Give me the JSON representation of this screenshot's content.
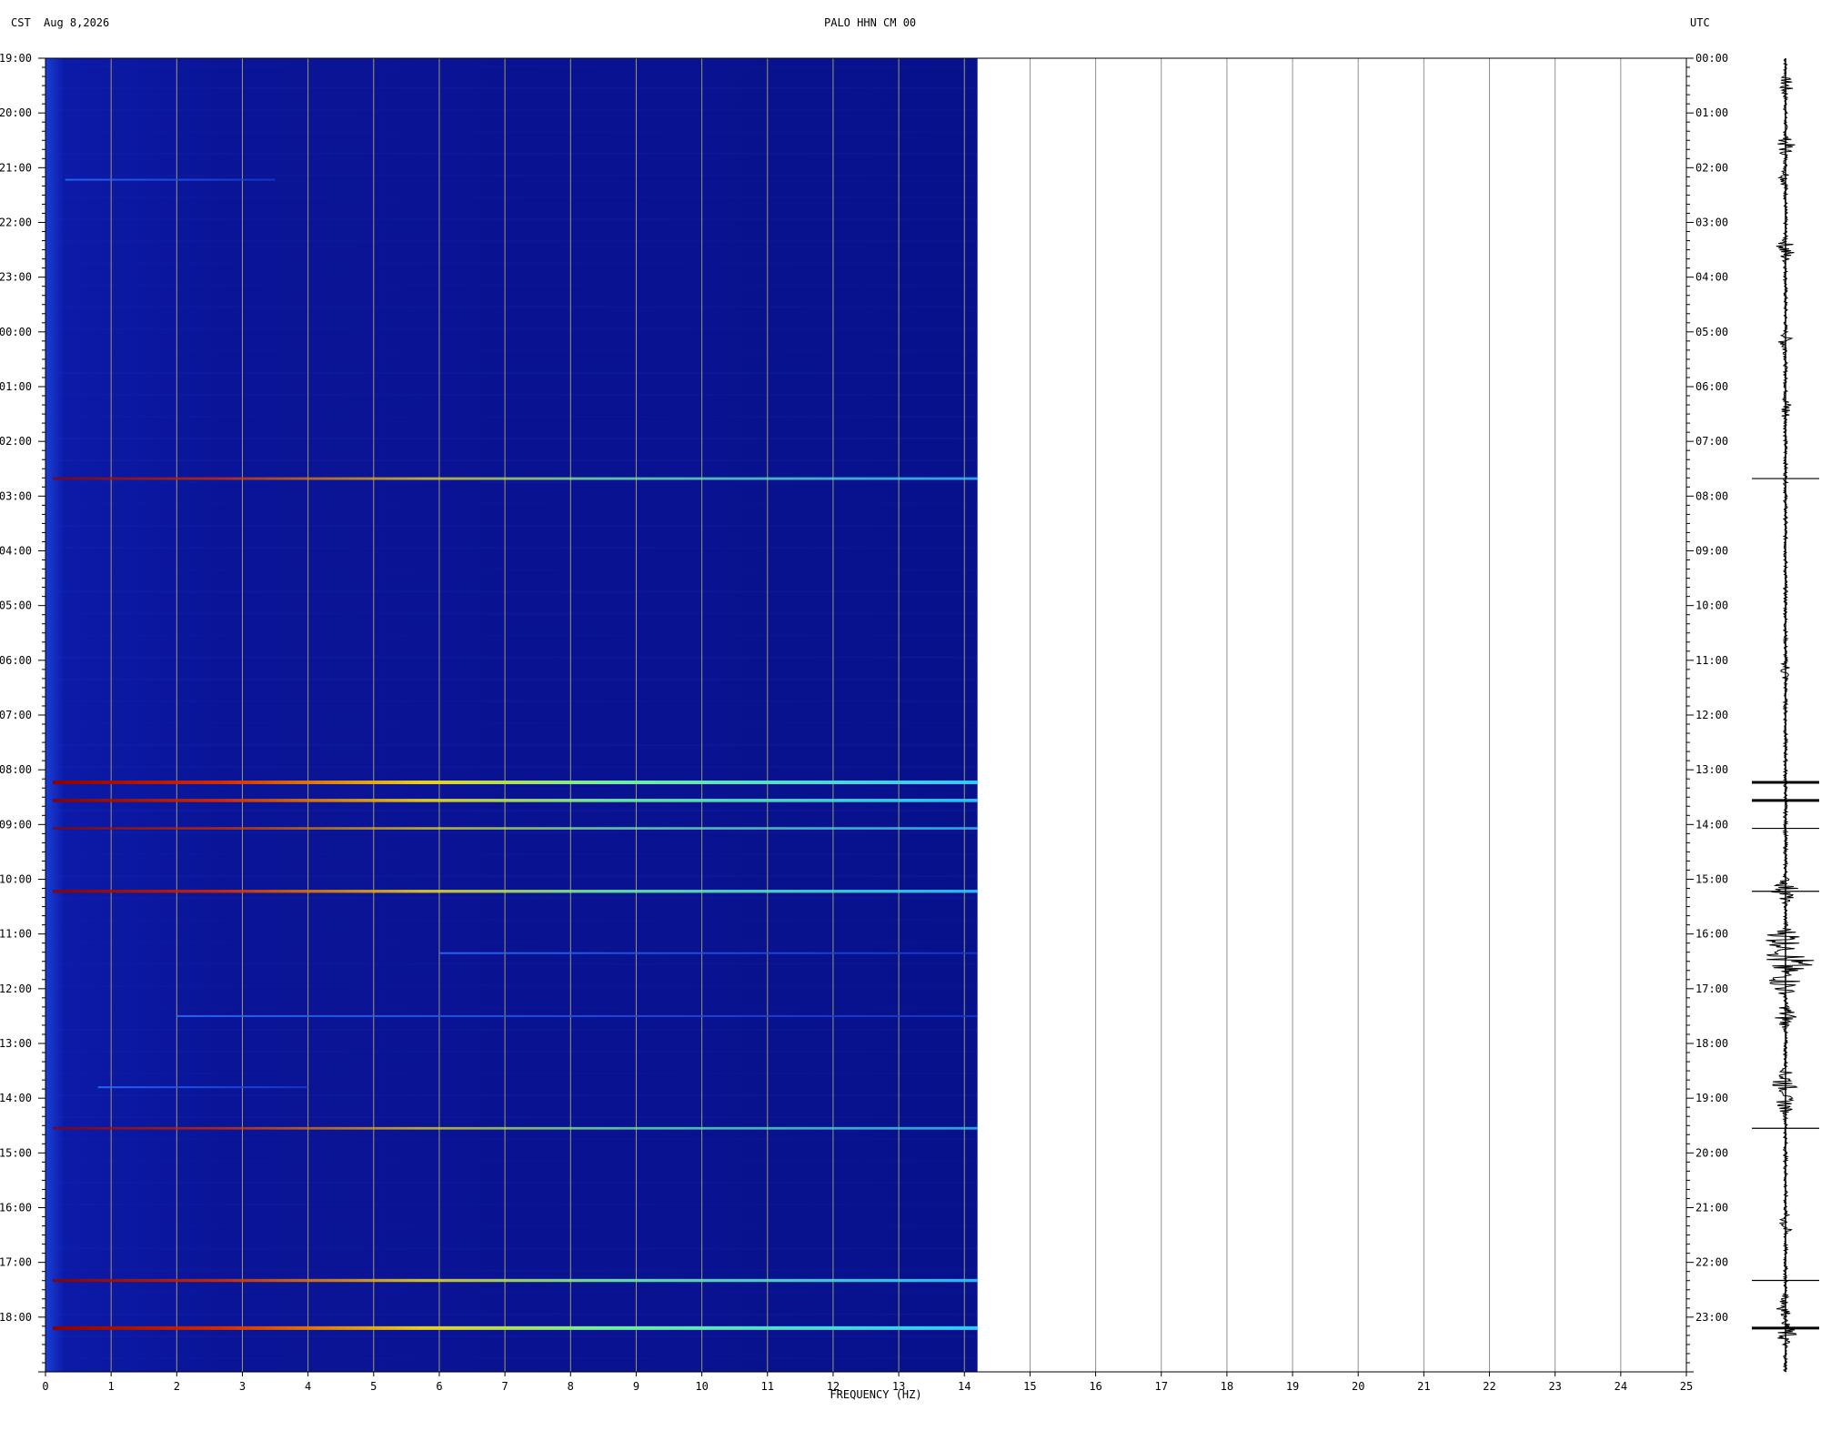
{
  "header": {
    "left_timezone": "CST",
    "date": "Aug 8,2026",
    "station": "PALO HHN CM 00",
    "right_timezone": "UTC"
  },
  "chart_data": {
    "type": "heatmap",
    "title": "PALO HHN CM 00",
    "xlabel": "FREQUENCY (HZ)",
    "ylabel": "",
    "x_ticks": [
      "0",
      "1",
      "2",
      "3",
      "4",
      "5",
      "6",
      "7",
      "8",
      "9",
      "10",
      "11",
      "12",
      "13",
      "14",
      "15",
      "16",
      "17",
      "18",
      "19",
      "20",
      "21",
      "22",
      "23",
      "24",
      "25"
    ],
    "xlim": [
      0,
      25
    ],
    "data_extent_hz": 14.2,
    "left_time_ticks": [
      "19:00",
      "20:00",
      "21:00",
      "22:00",
      "23:00",
      "00:00",
      "01:00",
      "02:00",
      "03:00",
      "04:00",
      "05:00",
      "06:00",
      "07:00",
      "08:00",
      "09:00",
      "10:00",
      "11:00",
      "12:00",
      "13:00",
      "14:00",
      "15:00",
      "16:00",
      "17:00",
      "18:00"
    ],
    "right_time_ticks": [
      "00:00",
      "01:00",
      "02:00",
      "03:00",
      "04:00",
      "05:00",
      "06:00",
      "07:00",
      "08:00",
      "09:00",
      "10:00",
      "11:00",
      "12:00",
      "13:00",
      "14:00",
      "15:00",
      "16:00",
      "17:00",
      "18:00",
      "19:00",
      "20:00",
      "21:00",
      "22:00",
      "23:00"
    ],
    "ylim_hours": [
      0,
      24
    ],
    "background_color": "#0a1496",
    "grid": true,
    "grid_color": "#a09a6a",
    "events": [
      {
        "utc_hour": 7.68,
        "strength": 0.55
      },
      {
        "utc_hour": 13.23,
        "strength": 1.0
      },
      {
        "utc_hour": 13.56,
        "strength": 0.85
      },
      {
        "utc_hour": 14.07,
        "strength": 0.5
      },
      {
        "utc_hour": 15.22,
        "strength": 0.75
      },
      {
        "utc_hour": 19.55,
        "strength": 0.5
      },
      {
        "utc_hour": 22.33,
        "strength": 0.75
      },
      {
        "utc_hour": 23.2,
        "strength": 1.0
      }
    ],
    "faint_streaks": [
      {
        "utc_hour": 2.22,
        "f_start": 0.3,
        "f_end": 3.5
      },
      {
        "utc_hour": 18.8,
        "f_start": 0.8,
        "f_end": 4.0
      },
      {
        "utc_hour": 16.35,
        "f_start": 6.0,
        "f_end": 14.2
      },
      {
        "utc_hour": 17.5,
        "f_start": 2.0,
        "f_end": 14.2
      }
    ],
    "seismogram_activity": [
      {
        "utc_hour": 0.5,
        "amp": 0.25
      },
      {
        "utc_hour": 1.6,
        "amp": 0.3
      },
      {
        "utc_hour": 2.2,
        "amp": 0.2
      },
      {
        "utc_hour": 3.5,
        "amp": 0.35
      },
      {
        "utc_hour": 5.2,
        "amp": 0.25
      },
      {
        "utc_hour": 6.4,
        "amp": 0.25
      },
      {
        "utc_hour": 11.2,
        "amp": 0.2
      },
      {
        "utc_hour": 15.2,
        "amp": 0.45
      },
      {
        "utc_hour": 16.1,
        "amp": 0.7
      },
      {
        "utc_hour": 16.5,
        "amp": 1.0
      },
      {
        "utc_hour": 16.9,
        "amp": 0.6
      },
      {
        "utc_hour": 17.5,
        "amp": 0.4
      },
      {
        "utc_hour": 18.7,
        "amp": 0.5
      },
      {
        "utc_hour": 19.1,
        "amp": 0.3
      },
      {
        "utc_hour": 21.3,
        "amp": 0.25
      },
      {
        "utc_hour": 22.8,
        "amp": 0.3
      },
      {
        "utc_hour": 23.3,
        "amp": 0.35
      }
    ]
  }
}
